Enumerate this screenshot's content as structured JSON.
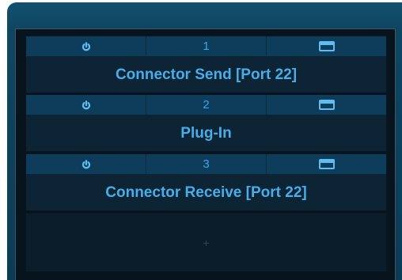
{
  "slots": [
    {
      "number": "1",
      "name": "Connector Send [Port 22]"
    },
    {
      "number": "2",
      "name": "Plug-In"
    },
    {
      "number": "3",
      "name": "Connector Receive [Port 22]"
    }
  ],
  "add_slot": {
    "label": "+"
  },
  "icons": {
    "power": "power-icon",
    "window": "window-icon"
  },
  "colors": {
    "accent_text": "#48adea",
    "slot_header": "#0e3d5b",
    "panel": "#0e4662"
  }
}
